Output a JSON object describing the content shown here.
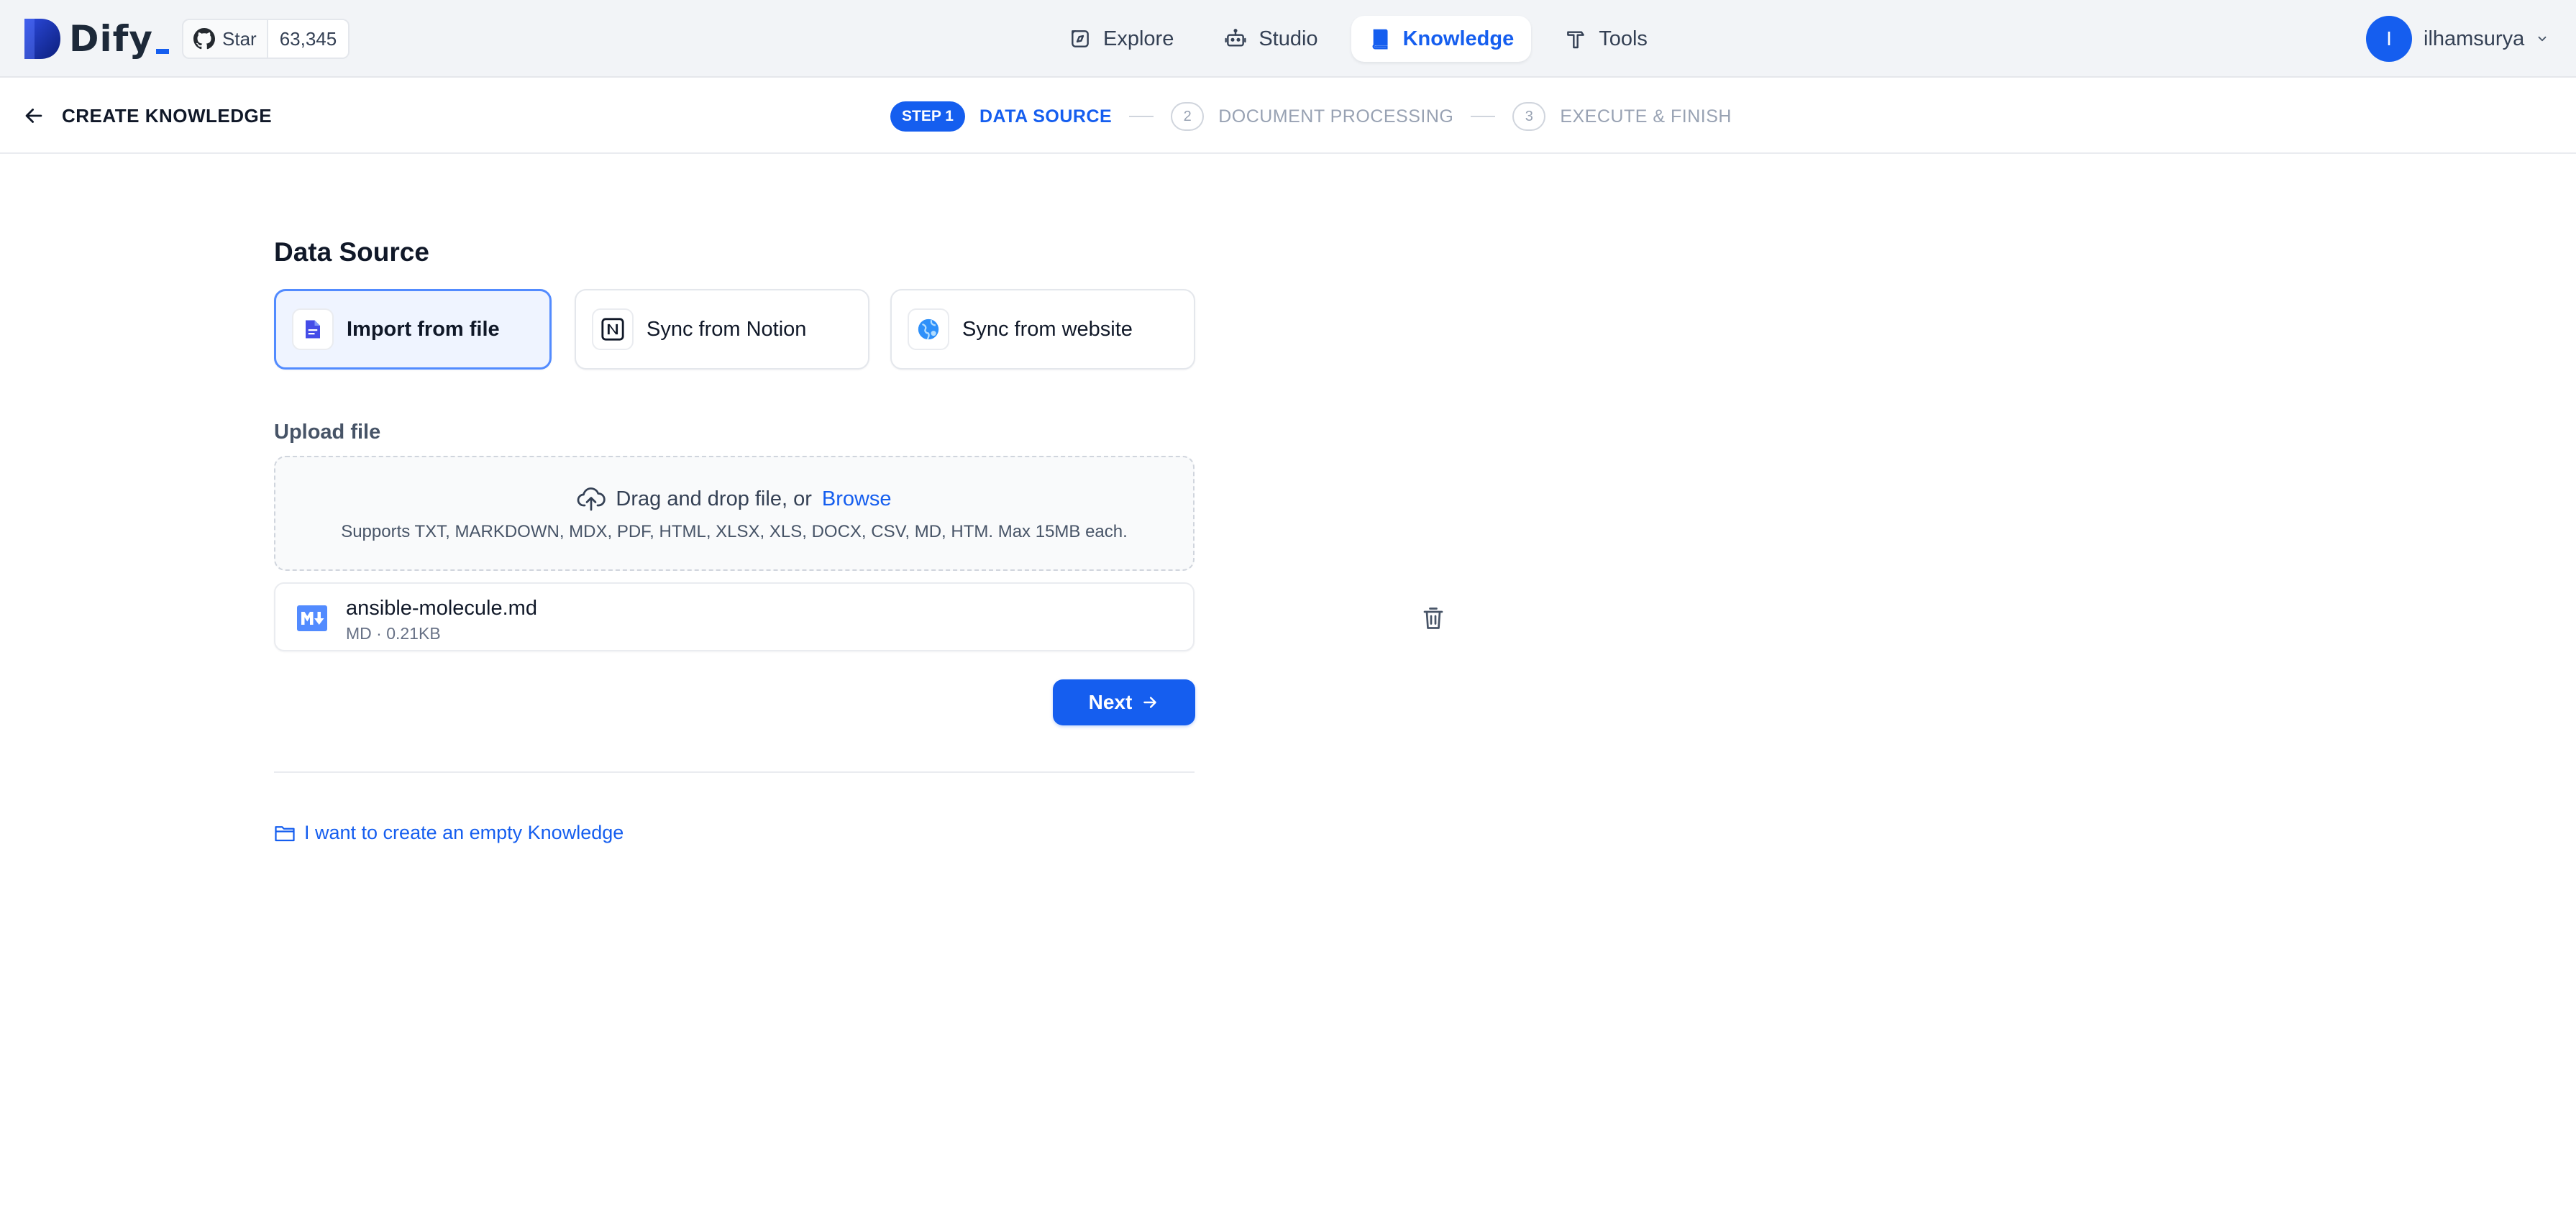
{
  "app": {
    "name": "Dify"
  },
  "github": {
    "star_label": "Star",
    "star_count": "63,345"
  },
  "nav": {
    "items": [
      {
        "label": "Explore",
        "icon": "compass-icon"
      },
      {
        "label": "Studio",
        "icon": "robot-icon"
      },
      {
        "label": "Knowledge",
        "icon": "book-icon",
        "active": true
      },
      {
        "label": "Tools",
        "icon": "hammer-icon"
      }
    ]
  },
  "user": {
    "initial": "I",
    "name": "ilhamsurya"
  },
  "header": {
    "title": "CREATE KNOWLEDGE",
    "steps": [
      {
        "badge": "STEP 1",
        "label": "DATA SOURCE",
        "active": true
      },
      {
        "number": "2",
        "label": "DOCUMENT PROCESSING"
      },
      {
        "number": "3",
        "label": "EXECUTE & FINISH"
      }
    ]
  },
  "data_source": {
    "title": "Data Source",
    "options": [
      {
        "label": "Import from file",
        "icon": "file-icon",
        "selected": true
      },
      {
        "label": "Sync from Notion",
        "icon": "notion-icon"
      },
      {
        "label": "Sync from website",
        "icon": "globe-icon"
      }
    ]
  },
  "upload": {
    "label": "Upload file",
    "drop_text": "Drag and drop file, or",
    "browse_text": "Browse",
    "supported": "Supports TXT, MARKDOWN, MDX, PDF, HTML, XLSX, XLS, DOCX, CSV, MD, HTM. Max 15MB each."
  },
  "files": [
    {
      "name": "ansible-molecule.md",
      "meta": "MD · 0.21KB",
      "icon": "markdown-file-icon"
    }
  ],
  "actions": {
    "next_label": "Next"
  },
  "empty_knowledge": {
    "label": "I want to create an empty Knowledge"
  },
  "colors": {
    "accent": "#155eef",
    "selected_border": "#528bff",
    "selected_bg": "#eff4ff"
  }
}
